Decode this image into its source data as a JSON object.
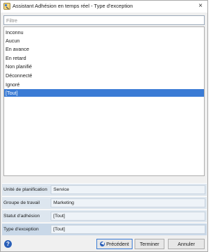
{
  "window": {
    "title": "Assistant Adhésion en temps réel - Type d'exception",
    "icon": "wizard-icon",
    "close_glyph": "×"
  },
  "filter": {
    "placeholder": "Filtre",
    "value": ""
  },
  "list": {
    "items": [
      {
        "label": "Inconnu",
        "selected": false
      },
      {
        "label": "Aucun",
        "selected": false
      },
      {
        "label": "En avance",
        "selected": false
      },
      {
        "label": "En retard",
        "selected": false
      },
      {
        "label": "Non planifié",
        "selected": false
      },
      {
        "label": "Déconnecté",
        "selected": false
      },
      {
        "label": "Ignoré",
        "selected": false
      },
      {
        "label": "[Tout]",
        "selected": true
      }
    ]
  },
  "properties": [
    {
      "label": "Unité de planification",
      "value": "Service"
    },
    {
      "label": "Groupe de travail",
      "value": "Marketing"
    },
    {
      "label": "Statut d'adhésion",
      "value": "[Tout]"
    },
    {
      "label": "Type d'exception",
      "value": "[Tout]"
    }
  ],
  "footer": {
    "help_glyph": "?",
    "prev_label": "Précédent",
    "prev_glyph": "◀",
    "finish_label": "Terminer",
    "cancel_label": "Annuler"
  },
  "colors": {
    "selection": "#3a7bd5",
    "property_background": "#dde6ef"
  }
}
